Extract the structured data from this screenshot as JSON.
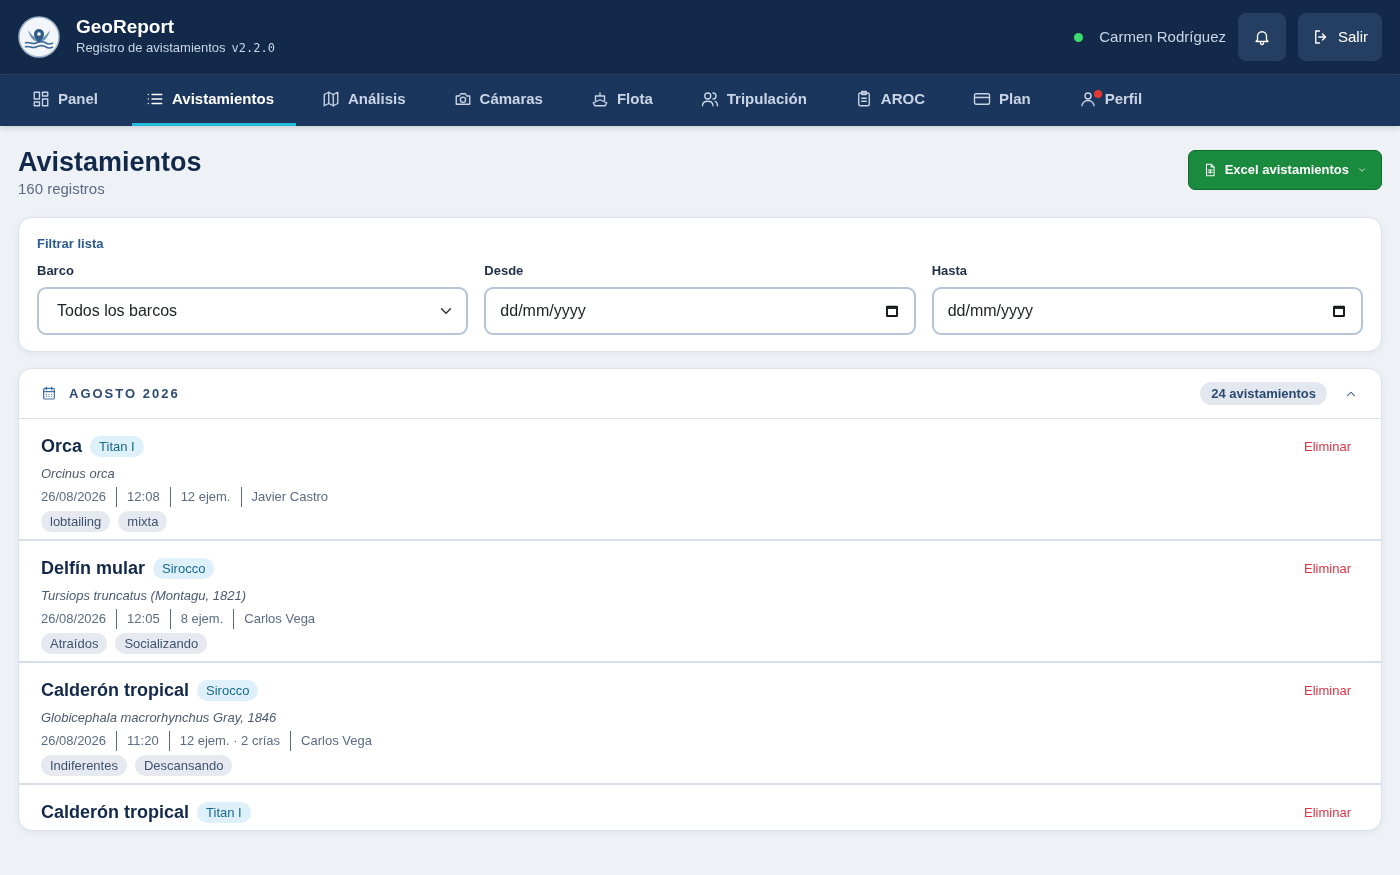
{
  "header": {
    "app_name": "GeoReport",
    "subtitle": "Registro de avistamientos",
    "version": "v2.2.0",
    "user": {
      "name": "Carmen Rodríguez",
      "online": true
    },
    "logout": "Salir"
  },
  "nav": [
    {
      "label": "Panel",
      "selected": false,
      "alert": false
    },
    {
      "label": "Avistamientos",
      "selected": true,
      "alert": false
    },
    {
      "label": "Análisis",
      "selected": false,
      "alert": false
    },
    {
      "label": "Cámaras",
      "selected": false,
      "alert": false
    },
    {
      "label": "Flota",
      "selected": false,
      "alert": false
    },
    {
      "label": "Tripulación",
      "selected": false,
      "alert": false
    },
    {
      "label": "AROC",
      "selected": false,
      "alert": false
    },
    {
      "label": "Plan",
      "selected": false,
      "alert": false
    },
    {
      "label": "Perfil",
      "selected": false,
      "alert": true
    }
  ],
  "page": {
    "title": "Avistamientos",
    "count": "160 registros",
    "export_button": "Excel avistamientos"
  },
  "filter": {
    "title": "Filtrar lista",
    "fields": [
      {
        "kind": "select",
        "label": "Barco",
        "value": "Todos los barcos"
      },
      {
        "kind": "date",
        "label": "Desde",
        "value": "dd/mm/yyyy"
      },
      {
        "kind": "date",
        "label": "Hasta",
        "value": "dd/mm/yyyy"
      }
    ]
  },
  "group": {
    "title": "AGOSTO 2026",
    "count": "24 avistamientos",
    "expanded": true,
    "records": [
      {
        "species": "Orca",
        "boat": "Titan I",
        "scientific": "Orcinus orca",
        "date": "26/08/2026",
        "time": "12:08",
        "count": "12 ejem.",
        "observer": "Javier Castro",
        "tags": [
          "lobtailing",
          "mixta"
        ],
        "action": "Eliminar"
      },
      {
        "species": "Delfín mular",
        "boat": "Sirocco",
        "scientific": "Tursiops truncatus (Montagu, 1821)",
        "date": "26/08/2026",
        "time": "12:05",
        "count": "8 ejem.",
        "observer": "Carlos Vega",
        "tags": [
          "Atraídos",
          "Socializando"
        ],
        "action": "Eliminar"
      },
      {
        "species": "Calderón tropical",
        "boat": "Sirocco",
        "scientific": "Globicephala macrorhynchus Gray, 1846",
        "date": "26/08/2026",
        "time": "11:20",
        "count": "12 ejem. · 2 crías",
        "observer": "Carlos Vega",
        "tags": [
          "Indiferentes",
          "Descansando"
        ],
        "action": "Eliminar"
      },
      {
        "species": "Calderón tropical",
        "boat": "Titan I",
        "action": "Eliminar"
      }
    ]
  }
}
